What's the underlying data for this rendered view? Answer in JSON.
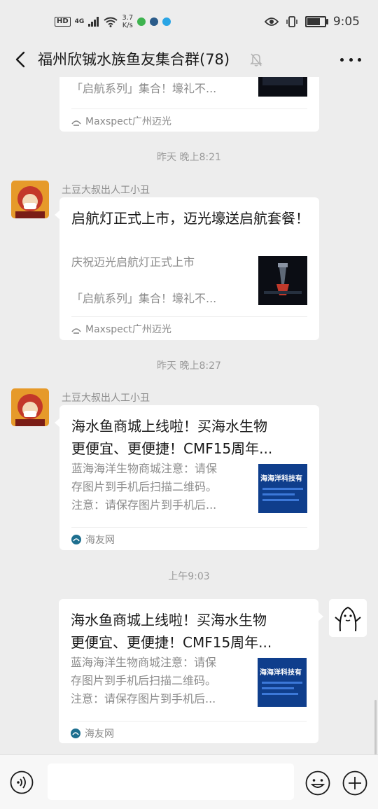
{
  "status_bar": {
    "hd": "HD",
    "network": "4G",
    "speed_top": "3.7",
    "speed_bottom": "K/s",
    "time": "9:05",
    "battery_level": 0.8
  },
  "header": {
    "title": "福州欣铖水族鱼友集合群(78)"
  },
  "messages": [
    {
      "desc": "「启航系列」集合！壕礼不...",
      "source": "Maxspect广州迈光"
    },
    {
      "timestamp": "昨天 晚上8:21",
      "sender": "土豆大叔出人工小丑",
      "title": "启航灯正式上市，迈光壕送启航套餐！",
      "desc_line1": "庆祝迈光启航灯正式上市",
      "desc_line2": "「启航系列」集合！壕礼不...",
      "source": "Maxspect广州迈光"
    },
    {
      "timestamp": "昨天 晚上8:27",
      "sender": "土豆大叔出人工小丑",
      "title_line1": "海水鱼商城上线啦！买海水生物",
      "title_line2": "更便宜、更便捷！CMF15周年...",
      "desc_line1": "蓝海海洋生物商城注意：请保",
      "desc_line2": "存图片到手机后扫描二维码。",
      "desc_line3": "注意：请保存图片到手机后...",
      "source": "海友网",
      "thumb_text": "海海洋科技有"
    },
    {
      "timestamp": "上午9:03",
      "title_line1": "海水鱼商城上线啦！买海水生物",
      "title_line2": "更便宜、更便捷！CMF15周年...",
      "desc_line1": "蓝海海洋生物商城注意：请保",
      "desc_line2": "存图片到手机后扫描二维码。",
      "desc_line3": "注意：请保存图片到手机后...",
      "source": "海友网",
      "thumb_text": "海海洋科技有"
    }
  ],
  "input": {
    "placeholder": ""
  },
  "icons": {
    "back": "chevron-left-icon",
    "mute": "bell-muted-icon",
    "more": "more-dots-icon",
    "voice": "voice-icon",
    "emoji": "emoji-icon",
    "plus": "plus-icon"
  },
  "colors": {
    "background": "#ededed",
    "bubble": "#ffffff",
    "meta_text": "#8c8c8c"
  }
}
